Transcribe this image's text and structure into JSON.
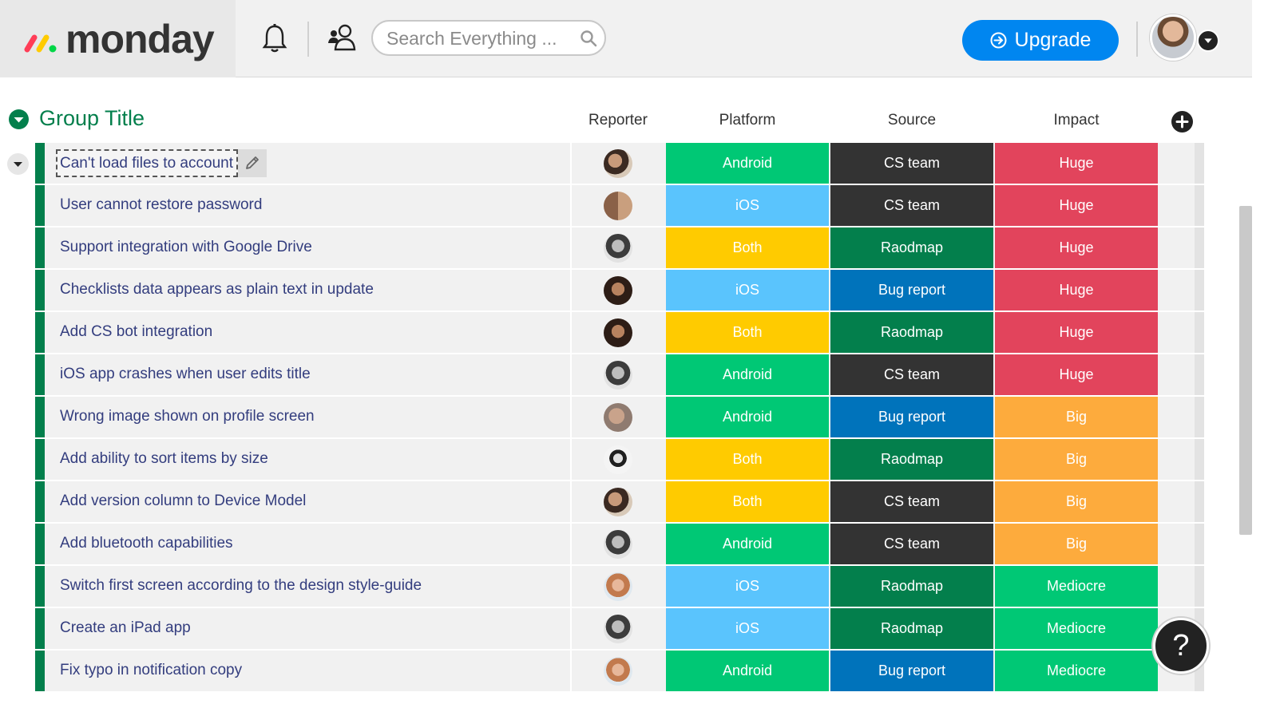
{
  "header": {
    "logo_text": "monday",
    "search_placeholder": "Search Everything ...",
    "upgrade_label": "Upgrade",
    "icons": [
      "bell-icon",
      "invite-members-icon",
      "search-icon",
      "upgrade-arrow-icon",
      "avatar",
      "chevron-down-icon"
    ]
  },
  "group": {
    "title": "Group Title",
    "color": "#037f4c"
  },
  "columns": [
    "Reporter",
    "Platform",
    "Source",
    "Impact"
  ],
  "colors": {
    "Android": "#00c875",
    "iOS": "#579bfc",
    "iOS_light": "#5ac4fd",
    "Both": "#ffcb00",
    "CS team": "#333333",
    "Raodmap": "#037f4c",
    "Bug report": "#0073bb",
    "Huge": "#e2445c",
    "Big": "#fdab3d",
    "Mediocre": "#00c875"
  },
  "rows": [
    {
      "name": "Can't load files to account",
      "platform": "Android",
      "source": "CS team",
      "impact": "Huge",
      "reporter": "avatar-woman-1"
    },
    {
      "name": "User cannot restore password",
      "platform": "iOS",
      "source": "CS team",
      "impact": "Huge",
      "reporter": "avatar-couple"
    },
    {
      "name": "Support integration with Google Drive",
      "platform": "Both",
      "source": "Raodmap",
      "impact": "Huge",
      "reporter": "avatar-man-bw"
    },
    {
      "name": "Checklists data appears as plain text in update",
      "platform": "iOS",
      "source": "Bug report",
      "impact": "Huge",
      "reporter": "avatar-man-dark"
    },
    {
      "name": "Add CS bot integration",
      "platform": "Both",
      "source": "Raodmap",
      "impact": "Huge",
      "reporter": "avatar-man-dark"
    },
    {
      "name": "iOS app crashes when user edits title",
      "platform": "Android",
      "source": "CS team",
      "impact": "Huge",
      "reporter": "avatar-man-bw"
    },
    {
      "name": "Wrong image shown on profile screen",
      "platform": "Android",
      "source": "Bug report",
      "impact": "Big",
      "reporter": "avatar-woman-2"
    },
    {
      "name": "Add ability to sort items by size",
      "platform": "Both",
      "source": "Raodmap",
      "impact": "Big",
      "reporter": "avatar-man-glasses"
    },
    {
      "name": "Add version column to Device Model",
      "platform": "Both",
      "source": "CS team",
      "impact": "Big",
      "reporter": "avatar-woman-1"
    },
    {
      "name": "Add bluetooth capabilities",
      "platform": "Android",
      "source": "CS team",
      "impact": "Big",
      "reporter": "avatar-man-bw"
    },
    {
      "name": "Switch first screen according to the design style-guide",
      "platform": "iOS",
      "source": "Raodmap",
      "impact": "Mediocre",
      "reporter": "avatar-woman-3"
    },
    {
      "name": "Create an iPad app",
      "platform": "iOS",
      "source": "Raodmap",
      "impact": "Mediocre",
      "reporter": "avatar-man-bw"
    },
    {
      "name": "Fix typo in notification copy",
      "platform": "Android",
      "source": "Bug report",
      "impact": "Mediocre",
      "reporter": "avatar-woman-3"
    }
  ],
  "help_label": "?"
}
